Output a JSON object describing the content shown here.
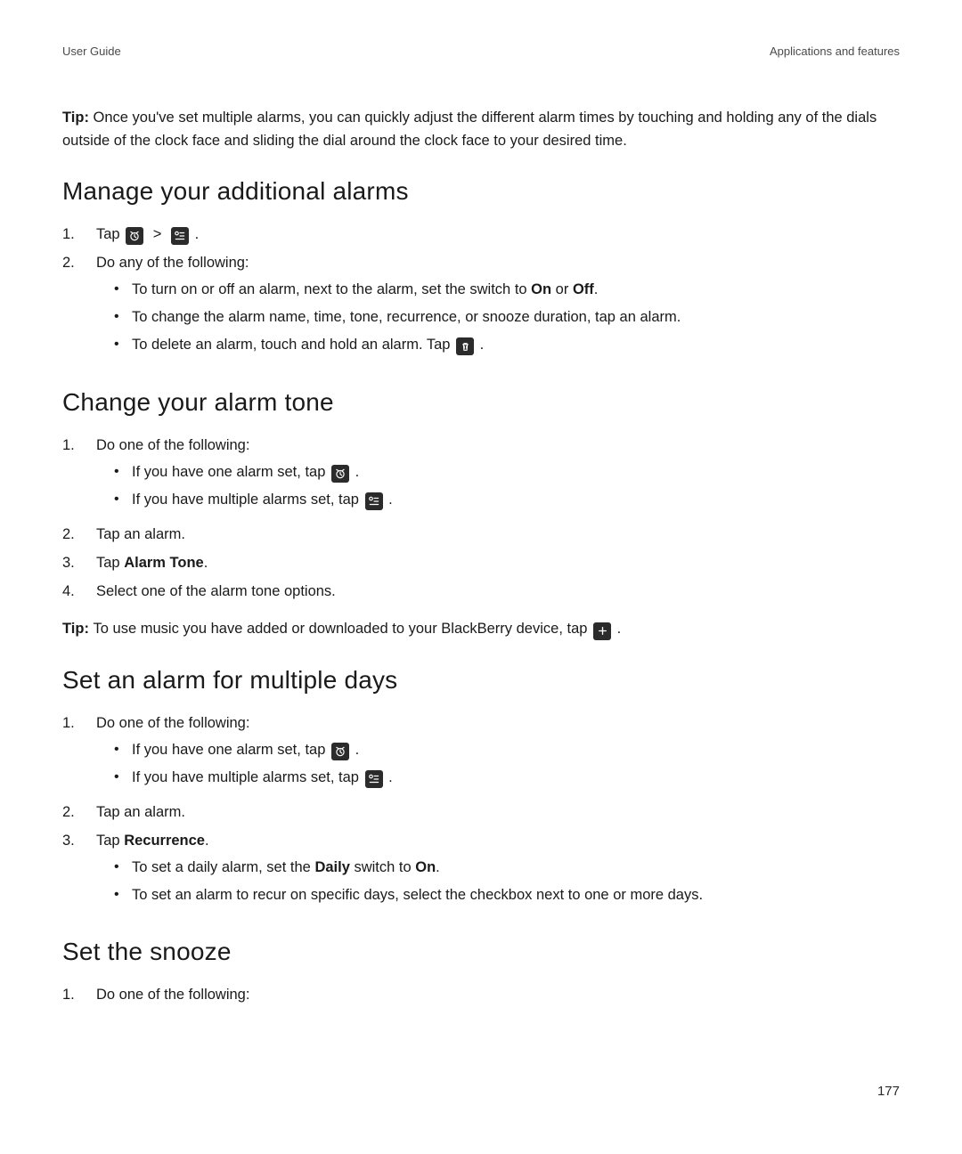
{
  "header": {
    "left": "User Guide",
    "right": "Applications and features"
  },
  "tip_top": {
    "label": "Tip: ",
    "text": "Once you've set multiple alarms, you can quickly adjust the different alarm times by touching and holding any of the dials outside of the clock face and sliding the dial around the clock face to your desired time."
  },
  "section_manage": {
    "title": "Manage your additional alarms",
    "step1_prefix": "Tap ",
    "step1_suffix": ".",
    "step2": "Do any of the following:",
    "bullets": {
      "b1_pre": "To turn on or off an alarm, next to the alarm, set the switch to ",
      "b1_on": "On",
      "b1_mid": " or ",
      "b1_off": "Off",
      "b1_post": ".",
      "b2": "To change the alarm name, time, tone, recurrence, or snooze duration, tap an alarm.",
      "b3_pre": "To delete an alarm, touch and hold an alarm. Tap ",
      "b3_post": " ."
    }
  },
  "section_tone": {
    "title": "Change your alarm tone",
    "step1": "Do one of the following:",
    "bullets": {
      "b1_pre": "If you have one alarm set, tap ",
      "b1_post": " .",
      "b2_pre": "If you have multiple alarms set, tap ",
      "b2_post": " ."
    },
    "step2": "Tap an alarm.",
    "step3_pre": "Tap ",
    "step3_bold": "Alarm Tone",
    "step3_post": ".",
    "step4": "Select one of the alarm tone options."
  },
  "tip_music": {
    "label": "Tip: ",
    "text_pre": "To use music you have added or downloaded to your BlackBerry device, tap ",
    "text_post": " ."
  },
  "section_multi": {
    "title": "Set an alarm for multiple days",
    "step1": "Do one of the following:",
    "bullets": {
      "b1_pre": "If you have one alarm set, tap ",
      "b1_post": " .",
      "b2_pre": "If you have multiple alarms set, tap ",
      "b2_post": " ."
    },
    "step2": "Tap an alarm.",
    "step3_pre": "Tap ",
    "step3_bold": "Recurrence",
    "step3_post": ".",
    "bullets2": {
      "b1_pre": "To set a daily alarm, set the ",
      "b1_daily": "Daily",
      "b1_mid": " switch to ",
      "b1_on": "On",
      "b1_post": ".",
      "b2": "To set an alarm to recur on specific days, select the checkbox next to one or more days."
    }
  },
  "section_snooze": {
    "title": "Set the snooze",
    "step1": "Do one of the following:"
  },
  "nums": {
    "n1": "1.",
    "n2": "2.",
    "n3": "3.",
    "n4": "4."
  },
  "gt": ">",
  "page_number": "177"
}
